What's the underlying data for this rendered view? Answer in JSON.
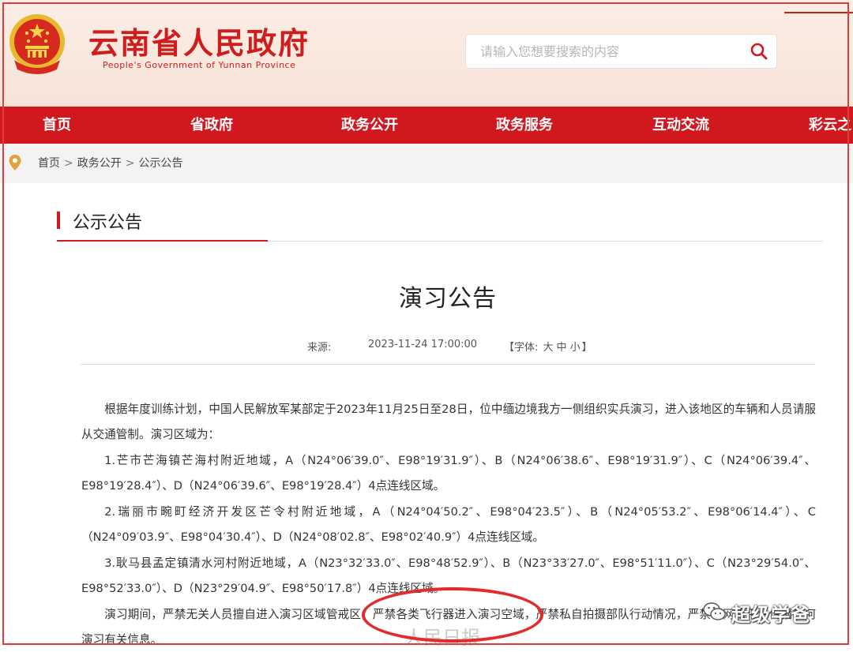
{
  "header": {
    "site_title": "云南省人民政府",
    "site_subtitle": "People's Government of Yunnan Province",
    "search_placeholder": "请输入您想要搜索的内容"
  },
  "nav": {
    "items": [
      "首页",
      "省政府",
      "政务公开",
      "政务服务",
      "互动交流",
      "彩云之"
    ]
  },
  "breadcrumb": {
    "items": [
      "首页",
      "政务公开",
      "公示公告"
    ],
    "separator": ">"
  },
  "section": {
    "title": "公示公告"
  },
  "article": {
    "title": "演习公告",
    "source_label": "来源:",
    "date": "2023-11-24 17:00:00",
    "font_label": "【字体:",
    "font_sizes": [
      "大",
      "中",
      "小"
    ],
    "font_close": "】",
    "paragraphs": [
      "根据年度训练计划，中国人民解放军某部定于2023年11月25日至28日，位中缅边境我方一侧组织实兵演习，进入该地区的车辆和人员请服从交通管制。演习区域为：",
      "1.芒市芒海镇芒海村附近地域，A（N24°06′39.0″、E98°19′31.9″）、B（N24°06′38.6″、E98°19′31.9″）、C（N24°06′39.4″、E98°19′28.4″）、D（N24°06′39.6″、E98°19′28.4″）4点连线区域。",
      "2.瑞丽市畹町经济开发区芒令村附近地域，A（N24°04′50.2″、E98°04′23.5″）、B（N24°05′53.2″、E98°06′14.4″）、C（N24°09′03.9″、E98°04′30.4″）、D（N24°08′02.8″、E98°02′40.9″）4点连线区域。",
      "3.耿马县孟定镇清水河村附近地域，A（N23°32′33.0″、E98°48′52.9″）、B（N23°33′27.0″、E98°51′11.0″）、C（N23°29′54.0″、E98°52′33.0″）、D（N23°29′04.9″、E98°50′17.8″）4点连线区域。",
      "演习期间，严禁无关人员擅自进入演习区域管戒区，严禁各类飞行器进入演习空域，严禁私自拍摄部队行动情况，严禁在网络平台传播任何演习有关信息。"
    ]
  },
  "watermarks": {
    "people_daily": "人民日报",
    "wechat_account": "超级学爸"
  },
  "colors": {
    "brand_red": "#d0181e",
    "header_bg": "#f7e3d7",
    "annotation_red": "#e32b2b"
  },
  "icons": [
    "national-emblem-icon",
    "search-icon",
    "location-pin-icon",
    "wechat-icon"
  ]
}
